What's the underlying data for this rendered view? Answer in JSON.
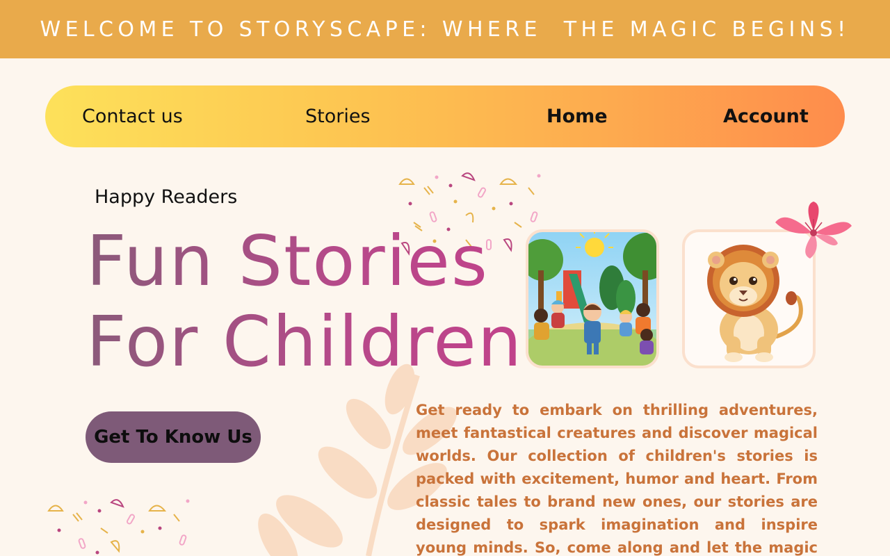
{
  "banner": {
    "text": "WELCOME TO STORYSCAPE: WHERE  THE MAGIC BEGINS!"
  },
  "nav": {
    "items": [
      {
        "label": "Contact us"
      },
      {
        "label": "Stories"
      },
      {
        "label": "Home"
      },
      {
        "label": "Account"
      }
    ]
  },
  "hero": {
    "eyebrow": "Happy Readers",
    "title_line1": "Fun Stories",
    "title_line2": "For Children",
    "cta_label": "Get To Know Us",
    "description": "Get ready to embark on thrilling adventures, meet fantastical creatures  and discover magical worlds. Our collection of children's stories is packed with excitement, humor and heart. From classic tales to brand new ones, our stories are designed to spark imagination and inspire young minds. So, come along and let the magic begin!\""
  },
  "colors": {
    "banner": "#e9aa4b",
    "nav_gradient_start": "#fde15a",
    "nav_gradient_end": "#fe8c4c",
    "title_gradient_start": "#8b5a7a",
    "title_gradient_end": "#c1428a",
    "cta": "#7e5a78",
    "description": "#c9733a",
    "background": "#fdf6ee"
  },
  "icons": {
    "playground_illustration": "children-playground-illustration",
    "lion_illustration": "cartoon-lion-illustration",
    "flower": "pink-lily-flower-icon",
    "leaf": "leaf-branch-decoration"
  }
}
